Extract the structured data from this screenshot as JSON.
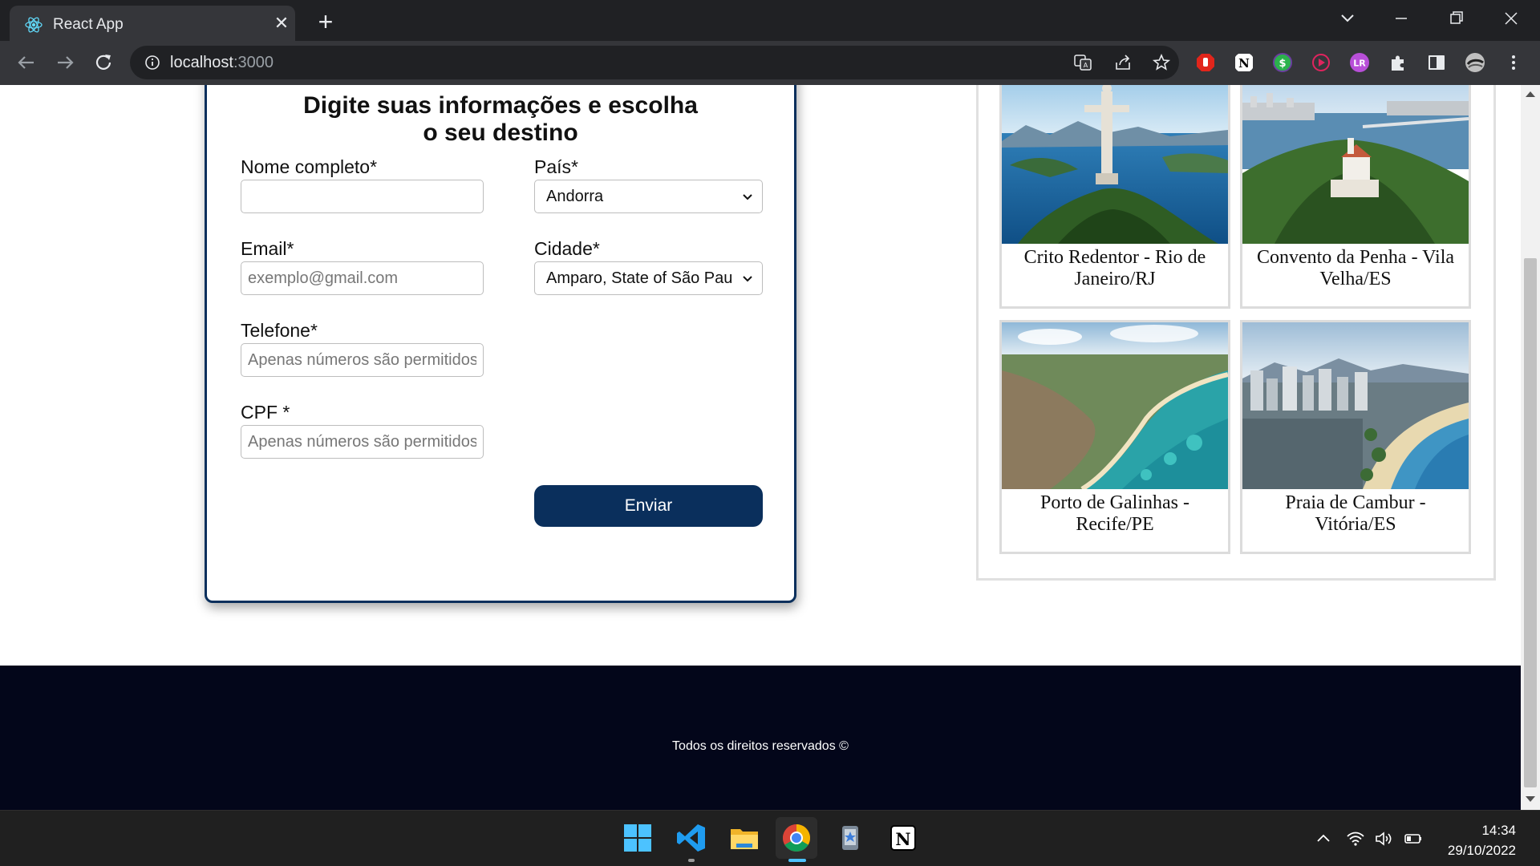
{
  "browser": {
    "tab_title": "React App",
    "tab_close": "✕",
    "new_tab": "+",
    "url_host": "localhost",
    "url_port": ":3000"
  },
  "form": {
    "title_line1": "Digite suas informações e escolha",
    "title_line2": "o seu destino",
    "name_label": "Nome completo*",
    "name_value": "",
    "email_label": "Email*",
    "email_placeholder": "exemplo@gmail.com",
    "phone_label": "Telefone*",
    "phone_placeholder": "Apenas números são permitidos",
    "cpf_label": "CPF *",
    "cpf_placeholder": "Apenas números são permitidos",
    "country_label": "País*",
    "country_value": "Andorra",
    "city_label": "Cidade*",
    "city_value": "Amparo, State of São Paulo",
    "submit_label": "Enviar"
  },
  "destinations": [
    {
      "label": "Crito Redentor - Rio de Janeiro/RJ"
    },
    {
      "label": "Convento da Penha - Vila Velha/ES"
    },
    {
      "label": "Porto de Galinhas - Recife/PE"
    },
    {
      "label": "Praia de Cambur - Vitória/ES"
    }
  ],
  "footer": {
    "text": "Todos os direitos reservados ©"
  },
  "taskbar": {
    "time": "14:34",
    "date": "29/10/2022"
  },
  "colors": {
    "brand": "#0a2f5c",
    "footer_bg": "#03061a",
    "chrome_dark": "#202124",
    "chrome_toolbar": "#35363a"
  }
}
